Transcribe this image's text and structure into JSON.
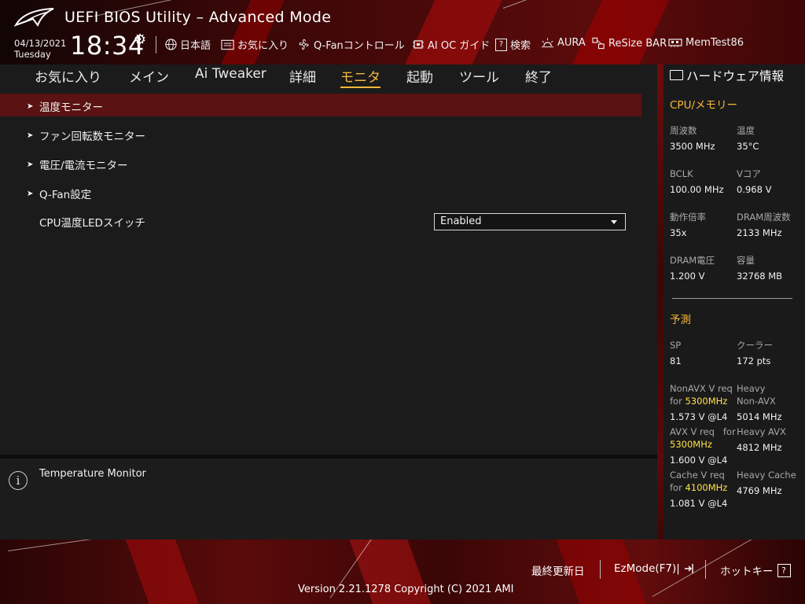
{
  "app": {
    "title": "UEFI BIOS Utility – Advanced Mode"
  },
  "header": {
    "date": "04/13/2021",
    "day": "Tuesday",
    "time": "18:34",
    "tools": [
      {
        "icon": "globe-icon",
        "label": "日本語"
      },
      {
        "icon": "favorites-icon",
        "label": "お気に入り"
      },
      {
        "icon": "fan-icon",
        "label": "Q-Fanコントロール"
      },
      {
        "icon": "ai-oc-icon",
        "label": "AI OC ガイド"
      },
      {
        "icon": "search-icon",
        "label": "検索"
      },
      {
        "icon": "aura-icon",
        "label": "AURA"
      },
      {
        "icon": "resize-bar-icon",
        "label": "ReSize BAR"
      },
      {
        "icon": "memtest-icon",
        "label": "MemTest86"
      }
    ]
  },
  "tabs": [
    {
      "label": "お気に入り"
    },
    {
      "label": "メイン"
    },
    {
      "label": "Ai Tweaker"
    },
    {
      "label": "詳細"
    },
    {
      "label": "モニタ",
      "active": true
    },
    {
      "label": "起動"
    },
    {
      "label": "ツール"
    },
    {
      "label": "終了"
    }
  ],
  "menu": {
    "items": [
      {
        "label": "温度モニター"
      },
      {
        "label": "ファン回転数モニター"
      },
      {
        "label": "電圧/電流モニター"
      },
      {
        "label": "Q-Fan設定"
      }
    ],
    "setting": {
      "label": "CPU温度LEDスイッチ",
      "value": "Enabled"
    }
  },
  "help": {
    "text": "Temperature Monitor"
  },
  "hw": {
    "title": "ハードウェア情報",
    "cpu_mem": {
      "title": "CPU/メモリー",
      "freq_label": "周波数",
      "freq": "3500 MHz",
      "temp_label": "温度",
      "temp": "35°C",
      "bclk_label": "BCLK",
      "bclk": "100.00 MHz",
      "vcore_label": "Vコア",
      "vcore": "0.968 V",
      "ratio_label": "動作倍率",
      "ratio": "35x",
      "dram_freq_label": "DRAM周波数",
      "dram_freq": "2133 MHz",
      "dram_volt_label": "DRAM電圧",
      "dram_volt": "1.200 V",
      "capacity_label": "容量",
      "capacity": "32768 MB"
    },
    "predict": {
      "title": "予測",
      "sp_label": "SP",
      "sp": "81",
      "cooler_label": "クーラー",
      "cooler": "172 pts",
      "nonavx_req_label": "NonAVX V req",
      "nonavx_for": "for",
      "nonavx_freq": "5300MHz",
      "nonavx_v": "1.573 V @L4",
      "heavy_label": "Heavy",
      "heavy_nonavx_label": "Non-AVX",
      "heavy_nonavx": "5014 MHz",
      "avx_req_label": "AVX V req",
      "avx_for": "for",
      "avx_freq": "5300MHz",
      "avx_v": "1.600 V @L4",
      "heavy_avx_label": "Heavy AVX",
      "heavy_avx": "4812 MHz",
      "cache_req_label": "Cache V req",
      "cache_for": "for",
      "cache_freq": "4100MHz",
      "cache_v": "1.081 V @L4",
      "heavy_cache_label": "Heavy Cache",
      "heavy_cache": "4769 MHz"
    }
  },
  "footer": {
    "last_modified": "最終更新日",
    "ezmode": "EzMode(F7)|",
    "hotkeys": "ホットキー",
    "hotkey_key": "?",
    "version": "Version 2.21.1278 Copyright (C) 2021 AMI"
  },
  "colors": {
    "accent": "#f6b73c",
    "highlight_row": "#5a1212",
    "freq_highlight": "#ffe14b",
    "brand_red": "#7a0c0c"
  }
}
